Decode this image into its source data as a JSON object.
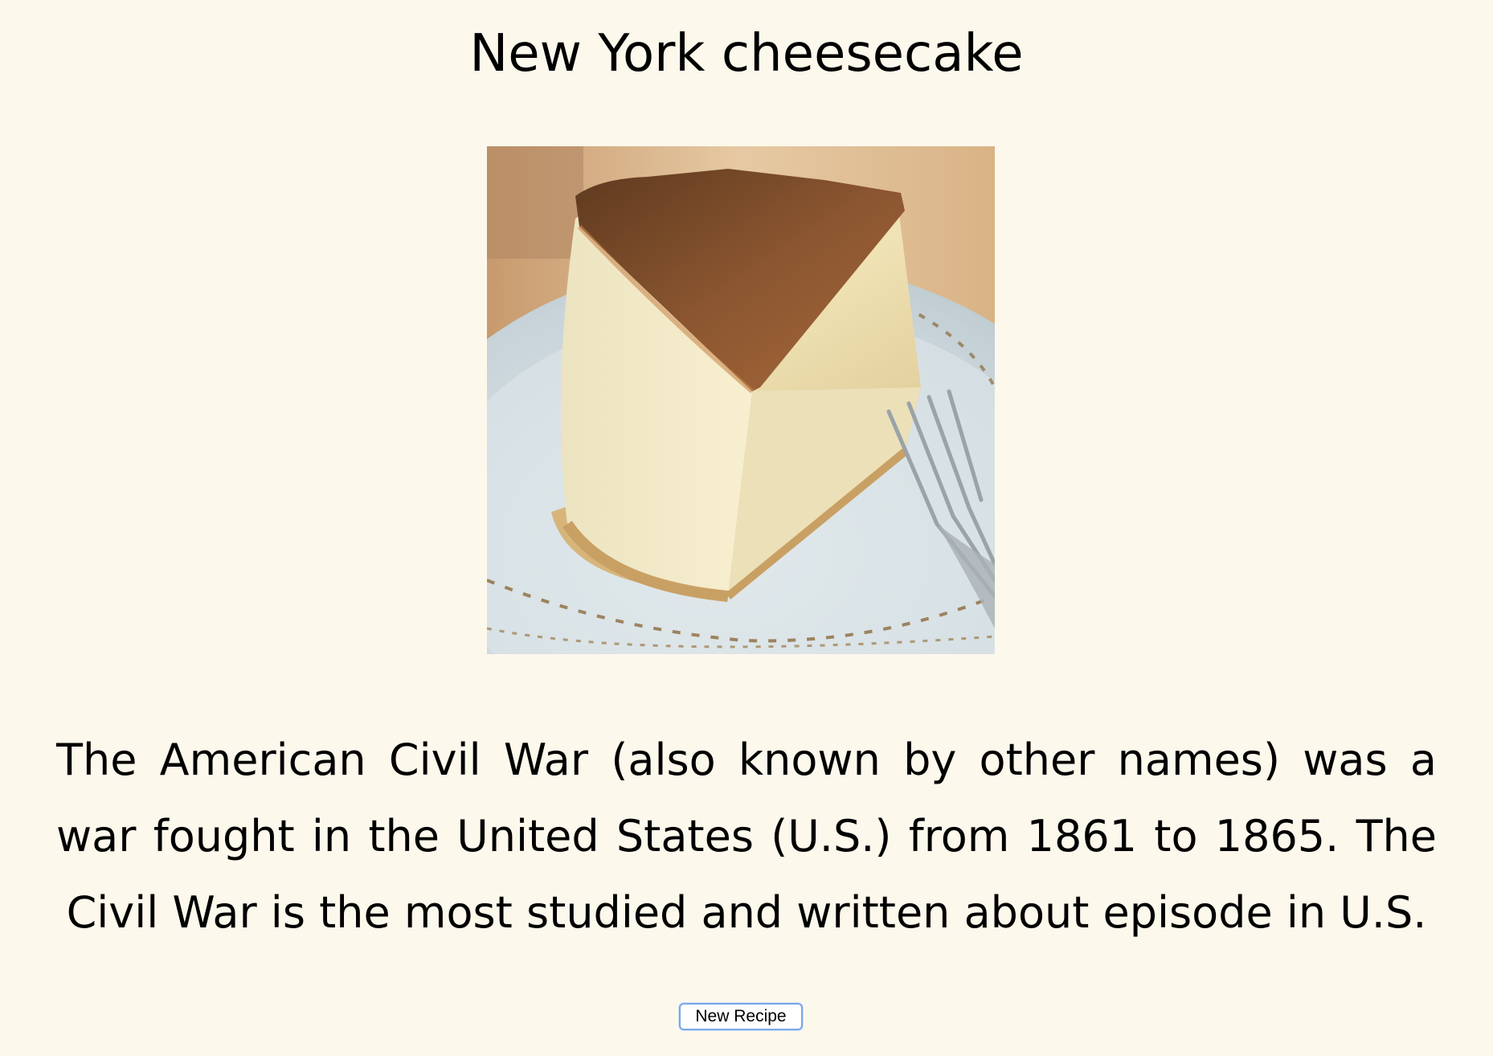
{
  "recipe": {
    "title": "New York cheesecake",
    "image_alt": "slice of New York cheesecake on a plate with a fork",
    "description": "The American Civil War (also known by other names) was a war fought in the United States (U.S.) from 1861 to 1865. The Civil War is the most studied and written about episode in U.S."
  },
  "actions": {
    "new_recipe_label": "New Recipe"
  },
  "colors": {
    "background": "#fdf8ec",
    "text": "#000000",
    "button_border": "#7aa7e6"
  }
}
